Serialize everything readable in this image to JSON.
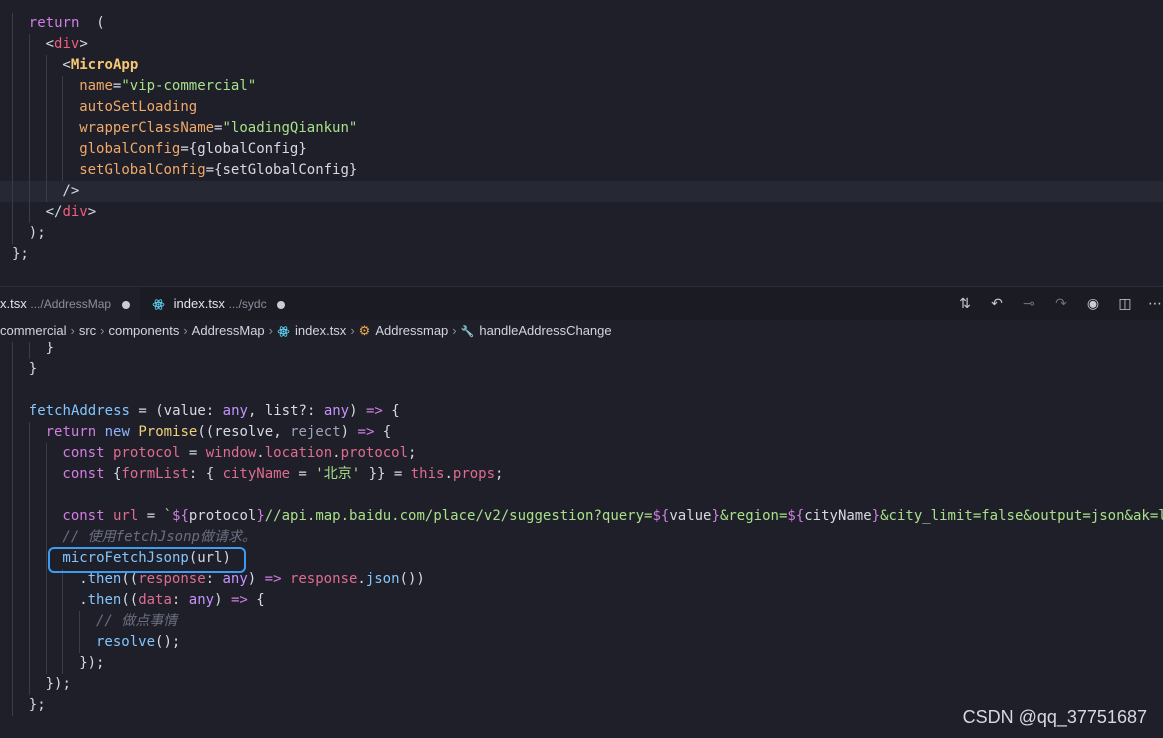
{
  "top_code": [
    {
      "i": 1,
      "segs": [
        [
          "k",
          "return"
        ],
        [
          "",
          "  ("
        ]
      ]
    },
    {
      "i": 2,
      "segs": [
        [
          "",
          "<"
        ],
        [
          "pk",
          "div"
        ],
        [
          "",
          ">"
        ]
      ]
    },
    {
      "i": 3,
      "segs": [
        [
          "",
          "<"
        ],
        [
          "t",
          "MicroApp"
        ]
      ]
    },
    {
      "i": 4,
      "segs": [
        [
          "a",
          "name"
        ],
        [
          "",
          "="
        ],
        [
          "s",
          "\"vip-commercial\""
        ]
      ]
    },
    {
      "i": 4,
      "segs": [
        [
          "a",
          "autoSetLoading"
        ]
      ]
    },
    {
      "i": 4,
      "segs": [
        [
          "a",
          "wrapperClassName"
        ],
        [
          "",
          "="
        ],
        [
          "s",
          "\"loadingQiankun\""
        ]
      ]
    },
    {
      "i": 4,
      "segs": [
        [
          "a",
          "globalConfig"
        ],
        [
          "",
          "={globalConfig}"
        ]
      ]
    },
    {
      "i": 4,
      "segs": [
        [
          "a",
          "setGlobalConfig"
        ],
        [
          "",
          "={setGlobalConfig}"
        ]
      ]
    },
    {
      "i": 3,
      "segs": [
        [
          "",
          "/>"
        ]
      ],
      "hl": true
    },
    {
      "i": 2,
      "segs": [
        [
          "",
          "</"
        ],
        [
          "pk",
          "div"
        ],
        [
          "",
          ">"
        ]
      ]
    },
    {
      "i": 1,
      "segs": [
        [
          "",
          ");"
        ]
      ]
    },
    {
      "i": 0,
      "segs": [
        [
          "",
          "};"
        ]
      ]
    }
  ],
  "tabs": {
    "active": {
      "name": "x.tsx",
      "path": ".../AddressMap"
    },
    "second": {
      "name": "index.tsx",
      "path": ".../sydc"
    }
  },
  "breadcrumb": {
    "parts": [
      "commercial",
      "src",
      "components",
      "AddressMap",
      "index.tsx",
      "Addressmap",
      "handleAddressChange"
    ]
  },
  "bottom_code": [
    {
      "i": 2,
      "segs": [
        [
          "",
          "}"
        ]
      ]
    },
    {
      "i": 1,
      "segs": [
        [
          "",
          "}"
        ]
      ]
    },
    {
      "i": 1,
      "segs": []
    },
    {
      "i": 1,
      "segs": [
        [
          "f",
          "fetchAddress"
        ],
        [
          "",
          " = (value: "
        ],
        [
          "ty",
          "any"
        ],
        [
          "",
          ", list?: "
        ],
        [
          "ty",
          "any"
        ],
        [
          "",
          ") "
        ],
        [
          "k",
          "=>"
        ],
        [
          "",
          " {"
        ]
      ]
    },
    {
      "i": 2,
      "segs": [
        [
          "k",
          "return"
        ],
        [
          "",
          " "
        ],
        [
          "kb",
          "new"
        ],
        [
          "",
          " "
        ],
        [
          "y",
          "Promise"
        ],
        [
          "",
          "((resolve, "
        ],
        [
          "m",
          "reject"
        ],
        [
          "",
          ") "
        ],
        [
          "k",
          "=>"
        ],
        [
          "",
          " {"
        ]
      ]
    },
    {
      "i": 3,
      "segs": [
        [
          "k",
          "const"
        ],
        [
          "",
          " "
        ],
        [
          "p",
          "protocol"
        ],
        [
          "",
          " = "
        ],
        [
          "p",
          "window"
        ],
        [
          "",
          "."
        ],
        [
          "p",
          "location"
        ],
        [
          "",
          "."
        ],
        [
          "p",
          "protocol"
        ],
        [
          "",
          ";"
        ]
      ]
    },
    {
      "i": 3,
      "segs": [
        [
          "k",
          "const"
        ],
        [
          "",
          " {"
        ],
        [
          "p",
          "formList"
        ],
        [
          "",
          ": { "
        ],
        [
          "p",
          "cityName"
        ],
        [
          "",
          " = "
        ],
        [
          "s",
          "'北京'"
        ],
        [
          "",
          " }} = "
        ],
        [
          "p",
          "this"
        ],
        [
          "",
          "."
        ],
        [
          "p",
          "props"
        ],
        [
          "",
          ";"
        ]
      ]
    },
    {
      "i": 3,
      "segs": []
    },
    {
      "i": 3,
      "segs": [
        [
          "k",
          "const"
        ],
        [
          "",
          " "
        ],
        [
          "p",
          "url"
        ],
        [
          "",
          " = "
        ],
        [
          "s",
          "`"
        ],
        [
          "k",
          "${"
        ],
        [
          "",
          "protocol"
        ],
        [
          "k",
          "}"
        ],
        [
          "s",
          "//api.map.baidu.com/place/v2/suggestion?query="
        ],
        [
          "k",
          "${"
        ],
        [
          "",
          "value"
        ],
        [
          "k",
          "}"
        ],
        [
          "s",
          "&region="
        ],
        [
          "k",
          "${"
        ],
        [
          "",
          "cityName"
        ],
        [
          "k",
          "}"
        ],
        [
          "s",
          "&city_limit=false&output=json&ak=l"
        ]
      ]
    },
    {
      "i": 3,
      "segs": [
        [
          "c",
          "// 使用fetchJsonp做请求。"
        ]
      ]
    },
    {
      "i": 3,
      "segs": [
        [
          "f",
          "microFetchJsonp"
        ],
        [
          "",
          "(url)"
        ]
      ]
    },
    {
      "i": 4,
      "segs": [
        [
          "",
          "."
        ],
        [
          "f",
          "then"
        ],
        [
          "",
          "(("
        ],
        [
          "p",
          "response"
        ],
        [
          "",
          ": "
        ],
        [
          "ty",
          "any"
        ],
        [
          "",
          ") "
        ],
        [
          "k",
          "=>"
        ],
        [
          "",
          " "
        ],
        [
          "p",
          "response"
        ],
        [
          "",
          "."
        ],
        [
          "f",
          "json"
        ],
        [
          "",
          "())"
        ]
      ]
    },
    {
      "i": 4,
      "segs": [
        [
          "",
          "."
        ],
        [
          "f",
          "then"
        ],
        [
          "",
          "(("
        ],
        [
          "p",
          "data"
        ],
        [
          "",
          ": "
        ],
        [
          "ty",
          "any"
        ],
        [
          "",
          ") "
        ],
        [
          "k",
          "=>"
        ],
        [
          "",
          " {"
        ]
      ]
    },
    {
      "i": 5,
      "segs": [
        [
          "c",
          "// 做点事情"
        ]
      ]
    },
    {
      "i": 5,
      "segs": [
        [
          "f",
          "resolve"
        ],
        [
          "",
          "();"
        ]
      ]
    },
    {
      "i": 4,
      "segs": [
        [
          "",
          "});"
        ]
      ]
    },
    {
      "i": 2,
      "segs": [
        [
          "",
          "});"
        ]
      ]
    },
    {
      "i": 1,
      "segs": [
        [
          "",
          "};"
        ]
      ]
    }
  ],
  "watermark": "CSDN @qq_37751687",
  "colors": {
    "background": "#1e1f29",
    "highlight_box": "#3d9cf0"
  }
}
